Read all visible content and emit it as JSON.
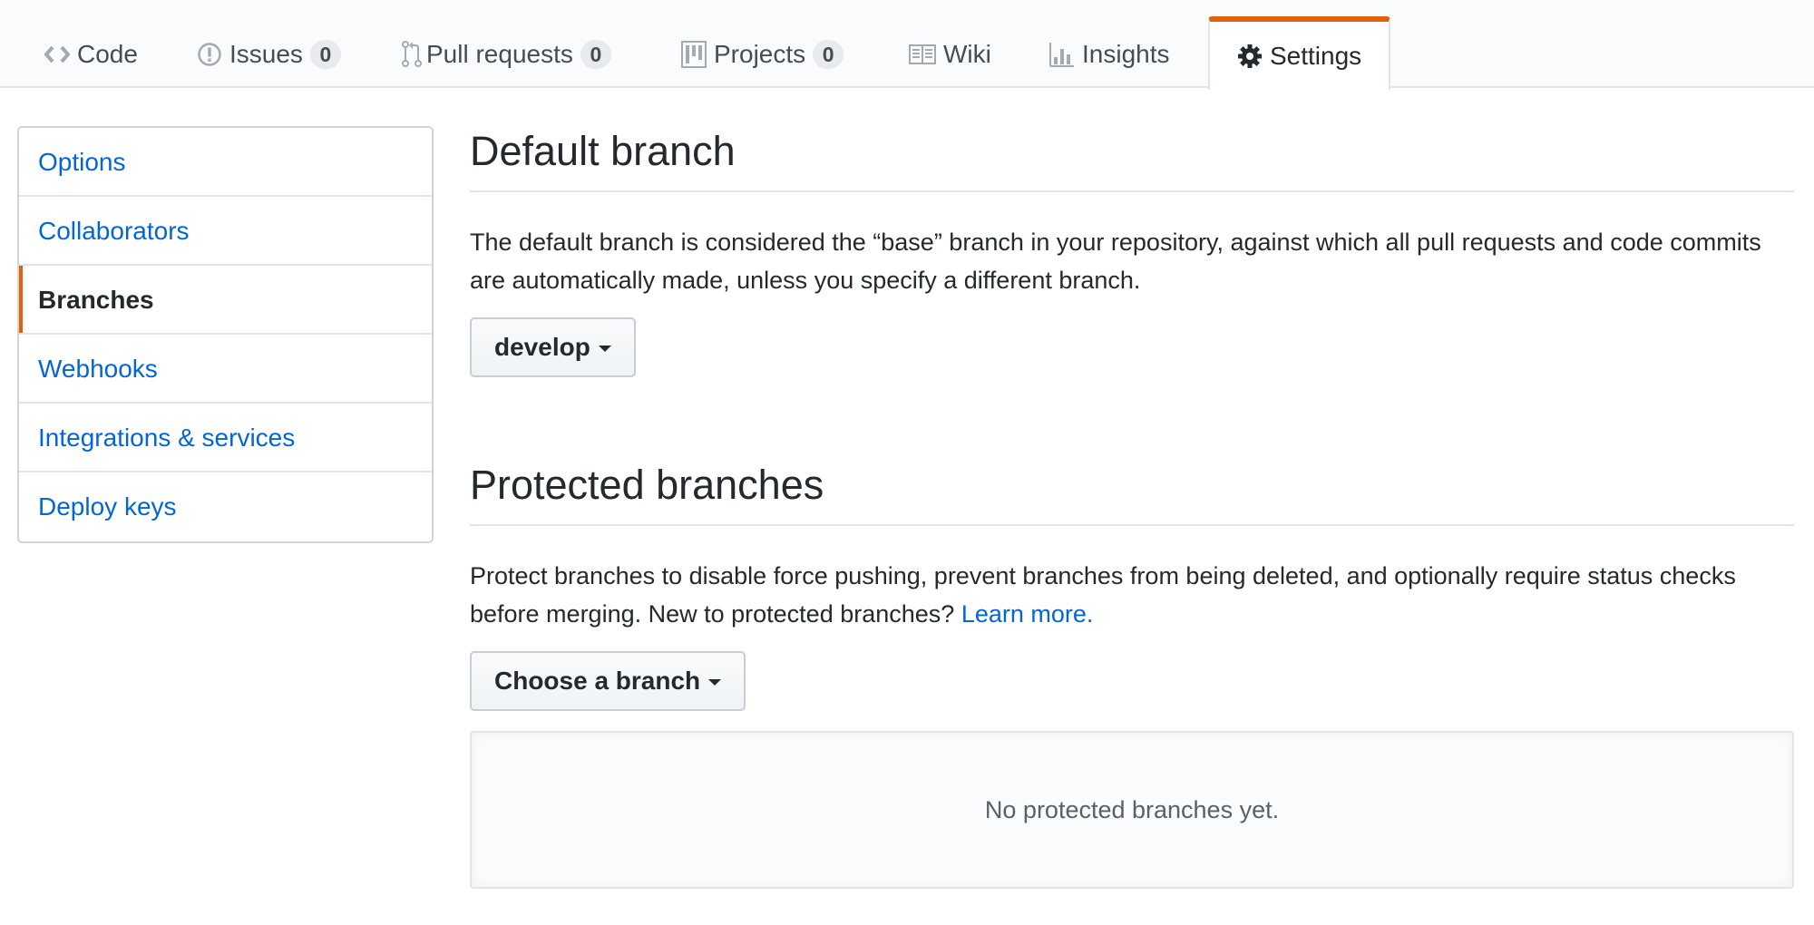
{
  "reponav": {
    "tabs": [
      {
        "label": "Code",
        "icon": "code-icon",
        "counter": null,
        "selected": false
      },
      {
        "label": "Issues",
        "icon": "issue-opened-icon",
        "counter": "0",
        "selected": false
      },
      {
        "label": "Pull requests",
        "icon": "git-pull-request-icon",
        "counter": "0",
        "selected": false
      },
      {
        "label": "Projects",
        "icon": "project-icon",
        "counter": "0",
        "selected": false
      },
      {
        "label": "Wiki",
        "icon": "book-icon",
        "counter": null,
        "selected": false
      },
      {
        "label": "Insights",
        "icon": "graph-icon",
        "counter": null,
        "selected": false
      },
      {
        "label": "Settings",
        "icon": "gear-icon",
        "counter": null,
        "selected": true
      }
    ]
  },
  "sidebar": {
    "items": [
      {
        "label": "Options",
        "selected": false
      },
      {
        "label": "Collaborators",
        "selected": false
      },
      {
        "label": "Branches",
        "selected": true
      },
      {
        "label": "Webhooks",
        "selected": false
      },
      {
        "label": "Integrations & services",
        "selected": false
      },
      {
        "label": "Deploy keys",
        "selected": false
      }
    ]
  },
  "default_branch": {
    "title": "Default branch",
    "description": "The default branch is considered the “base” branch in your repository, against which all pull requests and code commits are automatically made, unless you specify a different branch.",
    "selected_branch": "develop"
  },
  "protected_branches": {
    "title": "Protected branches",
    "description": "Protect branches to disable force pushing, prevent branches from being deleted, and optionally require status checks before merging. New to protected branches?",
    "learn_more_label": "Learn more.",
    "choose_branch_label": "Choose a branch",
    "empty_message": "No protected branches yet."
  },
  "colors": {
    "accent": "#e36209",
    "link": "#0366d6",
    "text": "#24292e",
    "muted": "#586069",
    "border": "#e1e4e8"
  }
}
